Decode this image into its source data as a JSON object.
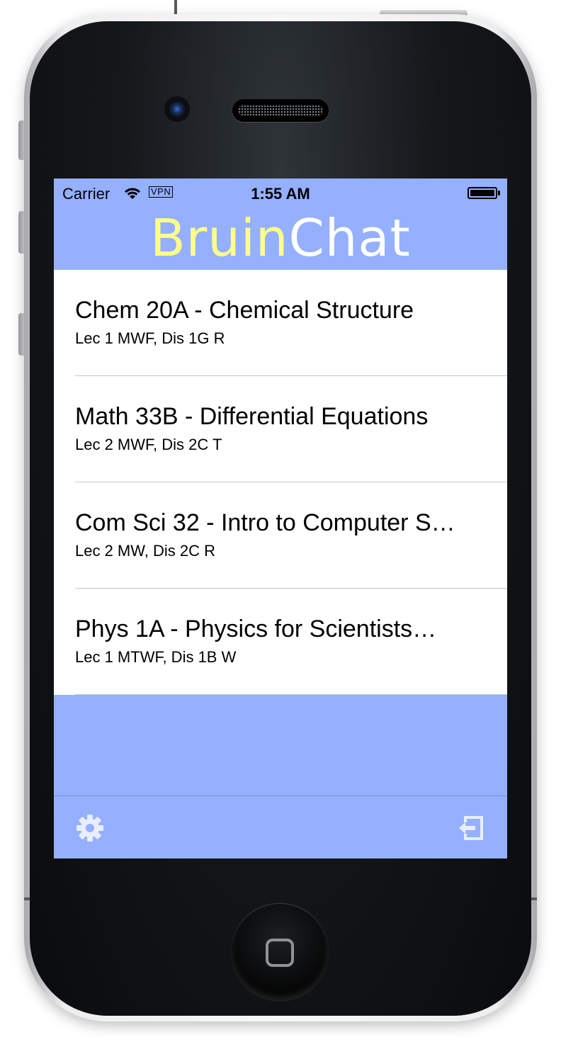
{
  "status_bar": {
    "carrier": "Carrier",
    "wifi_icon": "wifi-icon",
    "vpn": "VPN",
    "time": "1:55 AM",
    "battery_icon": "battery-full-icon"
  },
  "nav": {
    "title_part_1": "Bruin",
    "title_part_2": "Chat"
  },
  "courses": [
    {
      "name": "Chem 20A - Chemical Structure",
      "schedule": "Lec 1 MWF, Dis 1G R"
    },
    {
      "name": "Math 33B - Differential Equations",
      "schedule": "Lec 2 MWF, Dis 2C T"
    },
    {
      "name": "Com Sci 32 - Intro to Computer S…",
      "schedule": "Lec 2 MW, Dis 2C R"
    },
    {
      "name": "Phys 1A - Physics for Scientists…",
      "schedule": "Lec 1 MTWF, Dis 1B W"
    }
  ],
  "toolbar": {
    "left_icon": "gear-icon",
    "right_icon": "logout-icon"
  },
  "colors": {
    "screen_background": "#95b0ff",
    "title_accent": "#ffff88",
    "title_main": "#ffffff",
    "list_background": "#ffffff",
    "toolbar_icon": "#e8eeff"
  }
}
